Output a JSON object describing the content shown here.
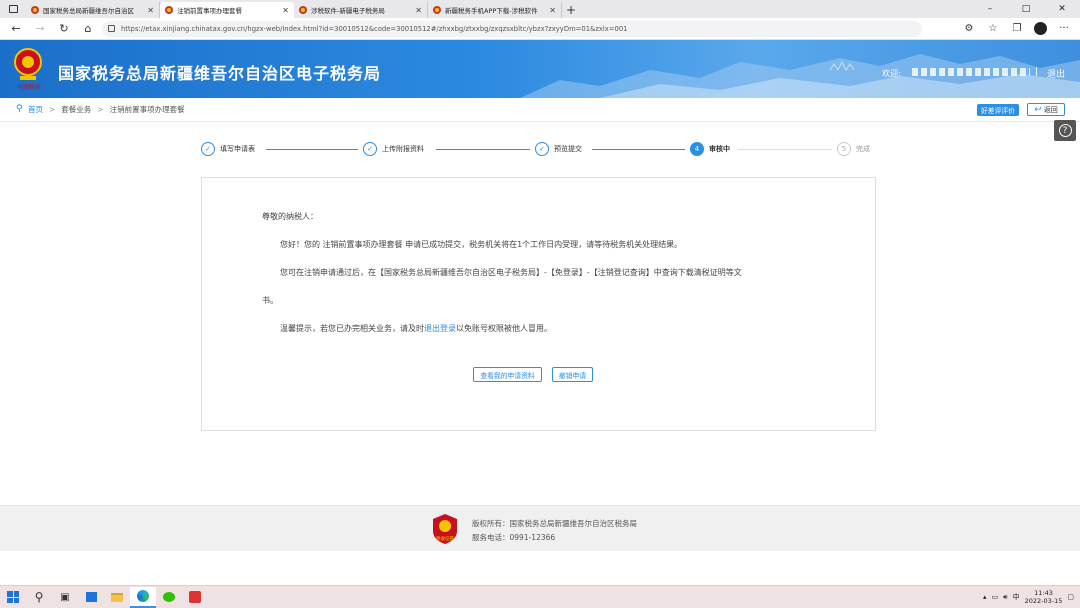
{
  "browser": {
    "tabs": [
      {
        "title": "国家税务总局新疆维吾尔自治区",
        "active": false
      },
      {
        "title": "注销前置事项办理套餐",
        "active": true
      },
      {
        "title": "涉税软件-新疆电子税务局",
        "active": false
      },
      {
        "title": "新疆税务手机APP下载-涉税软件",
        "active": false
      }
    ],
    "url": "https://etax.xinjiang.chinatax.gov.cn/hgzx-web/index.html?id=30010512&code=30010512#/zhxxbg/ztxxbg/zxqzsxbltc/ybzx?zxyyDm=01&zxlx=001",
    "win_minimize": "–",
    "win_maximize": "□",
    "win_close": "✕",
    "new_tab": "+",
    "more": "···"
  },
  "header": {
    "site_title": "国家税务总局新疆维吾尔自治区电子税务局",
    "welcome_label": "欢迎:",
    "separator": "|",
    "logout": "退出",
    "emblem_caption": "中国税务"
  },
  "breadcrumb": {
    "items": [
      "首页",
      "套餐业务",
      "注销前置事项办理套餐"
    ],
    "separator": ">",
    "rate_button": "好差评评价",
    "back_button": "返回"
  },
  "help": {
    "icon": "?"
  },
  "steps": [
    {
      "label": "填写申请表",
      "status": "done",
      "mark": "✓"
    },
    {
      "label": "上传附报资料",
      "status": "done",
      "mark": "✓"
    },
    {
      "label": "预览提交",
      "status": "done",
      "mark": "✓"
    },
    {
      "label": "审核中",
      "status": "current",
      "mark": "4"
    },
    {
      "label": "完成",
      "status": "todo",
      "mark": "5"
    }
  ],
  "card": {
    "greeting": "尊敬的纳税人：",
    "line1": "您好！您的 注销前置事项办理套餐 申请已成功提交，税务机关将在1个工作日内受理，请等待税务机关处理结果。",
    "line2": "您可在注销申请通过后，在【国家税务总局新疆维吾尔自治区电子税务局】-【免登录】-【注销登记查询】中查询下载清税证明等文",
    "line3": "书。",
    "tip_before": "温馨提示，若您已办完相关业务，请及时",
    "tip_link": "退出登录",
    "tip_after": "以免账号权限被他人冒用。",
    "view_button": "查看我的申请资料",
    "withdraw_button": "撤销申请"
  },
  "footer": {
    "copyright": "版权所有：国家税务总局新疆维吾尔自治区税务局",
    "phone": "服务电话：0991-12366",
    "logo_caption": "税收征管"
  },
  "taskbar": {
    "ime": "中",
    "time": "11:43",
    "date": "2022-03-15"
  },
  "colors": {
    "accent": "#2b8fe6",
    "header_blue": "#1b6fc8"
  }
}
